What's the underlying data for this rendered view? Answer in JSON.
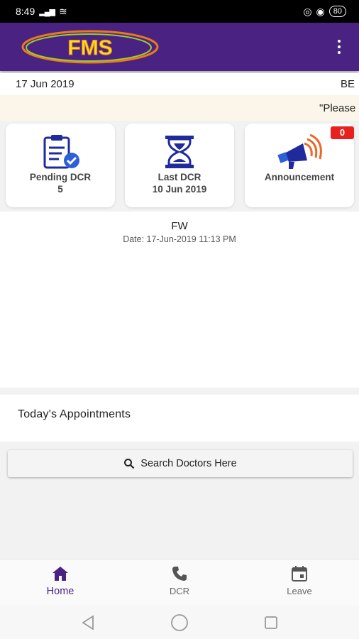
{
  "status_bar": {
    "time": "8:49",
    "signal": "...ıl",
    "battery": "80"
  },
  "app_bar": {
    "logo_text": "FMS"
  },
  "date_row": {
    "date": "17 Jun 2019",
    "right": "BE"
  },
  "marquee": {
    "text": "\"Please"
  },
  "cards": [
    {
      "label_line1": "Pending DCR",
      "label_line2": "5",
      "icon": "clipboard-check-icon"
    },
    {
      "label_line1": "Last DCR",
      "label_line2": "10 Jun 2019",
      "icon": "hourglass-icon"
    },
    {
      "label_line1": "Announcement",
      "label_line2": "",
      "icon": "megaphone-icon",
      "badge": "0"
    }
  ],
  "fw": {
    "title": "FW",
    "date": "Date: 17-Jun-2019 11:13 PM"
  },
  "appointments": {
    "title": "Today's Appointments"
  },
  "search": {
    "label": "Search Doctors Here"
  },
  "bottom_nav": [
    {
      "label": "Home",
      "icon": "home-icon",
      "active": true
    },
    {
      "label": "DCR",
      "icon": "phone-icon",
      "active": false
    },
    {
      "label": "Leave",
      "icon": "calendar-icon",
      "active": false
    }
  ],
  "colors": {
    "primary": "#4a2382",
    "badge": "#e8211f",
    "marquee_bg": "#fbf6e9"
  }
}
